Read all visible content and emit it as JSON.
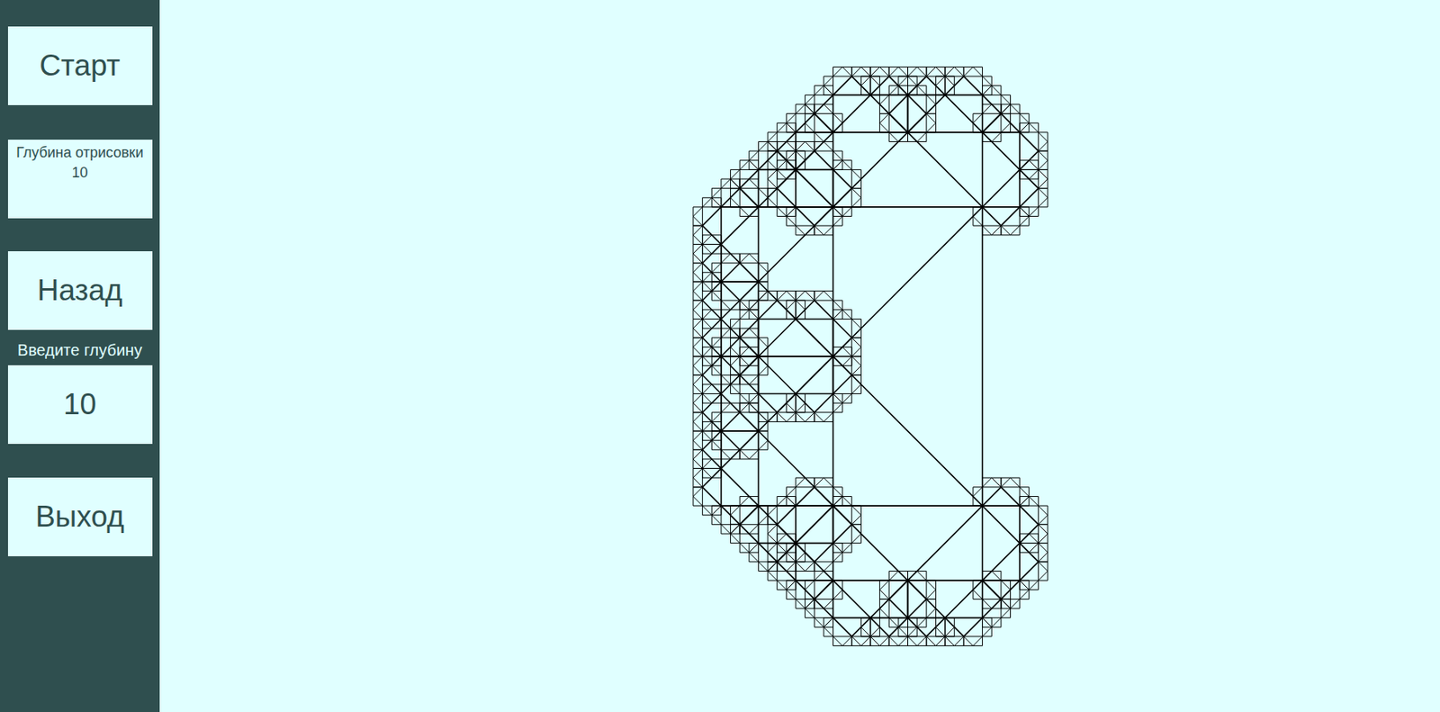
{
  "sidebar": {
    "start_button": "Старт",
    "depth_info": {
      "label": "Глубина отрисовки",
      "value": "10"
    },
    "back_button": "Назад",
    "depth_input": {
      "label": "Введите глубину",
      "value": "10"
    },
    "exit_button": "Выход"
  },
  "canvas": {
    "depth": 10
  }
}
